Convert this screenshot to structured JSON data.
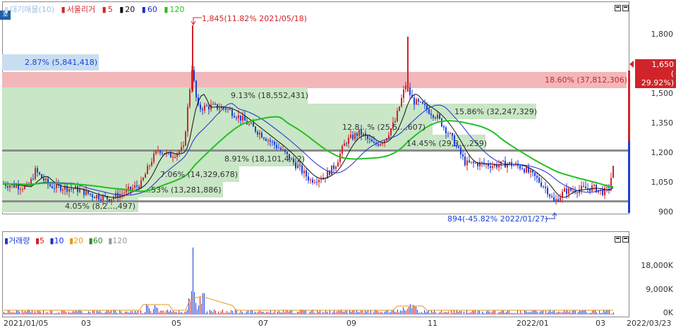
{
  "price_legend": {
    "title": "대기매물(10)",
    "ma_label": "서울리거",
    "ma5": "5",
    "ma20": "20",
    "ma60": "60",
    "ma120": "120"
  },
  "volume_legend": {
    "title": "거래량",
    "ma5": "5",
    "ma10": "10",
    "ma20": "20",
    "ma60": "60",
    "ma120": "120"
  },
  "badge": "호",
  "y_axis_price": [
    "1,800",
    "1,650",
    "1,500",
    "1,350",
    "1,200",
    "1,050",
    "900"
  ],
  "y_axis_volume": [
    "18,000K",
    "9,000K",
    "0K"
  ],
  "x_axis": [
    "2021/01/05",
    "03",
    "05",
    "07",
    "09",
    "11",
    "2022/01",
    "03",
    "2022/03/23"
  ],
  "current_price": {
    "value": "1,650",
    "change": "( 29.92%)"
  },
  "high_annotation": "1,845(11.82% 2021/05/18)",
  "low_annotation": "894(-45.82% 2022/01/27)",
  "volume_profile": [
    {
      "label": "2.87% (5,841,418)"
    },
    {
      "label": "18.60% (37,812,306)"
    },
    {
      "label": "9.13% (18,552,431)"
    },
    {
      "label": "15.86% (32,247,329)"
    },
    {
      "label": "12.8…% (25,5…,607)"
    },
    {
      "label": "14.45% (29,3…,259)"
    },
    {
      "label": "8.91% (18,101,4…2)"
    },
    {
      "label": "7.06% (14,329,678)"
    },
    {
      "label": "…53% (13,281,886)"
    },
    {
      "label": "4.05% (8,2…,497)"
    }
  ],
  "colors": {
    "up": "#d0242a",
    "down": "#1d3fd8",
    "ma5": "#d0242a",
    "ma20": "#111111",
    "ma60": "#1d2fcf",
    "ma120": "#22c022",
    "profile_green": "#c9e6c6",
    "profile_red": "#f2b7b9",
    "profile_blue": "#c8def0"
  }
}
